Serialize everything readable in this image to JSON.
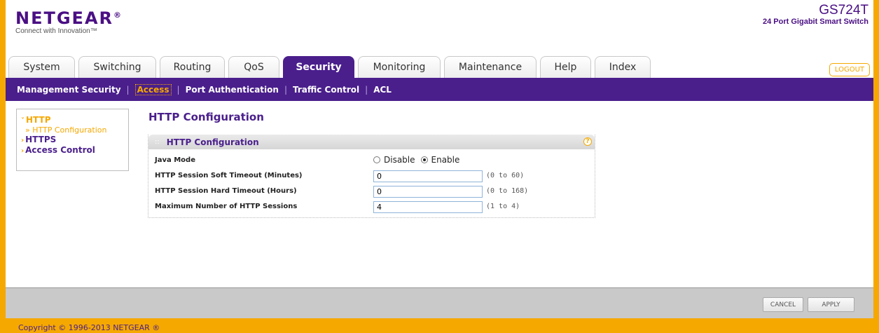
{
  "header": {
    "logo": "NETGEAR",
    "logo_mark": "®",
    "tagline": "Connect with Innovation™",
    "model": "GS724T",
    "description": "24 Port Gigabit Smart Switch",
    "logout_label": "LOGOUT"
  },
  "tabs": [
    {
      "label": "System"
    },
    {
      "label": "Switching"
    },
    {
      "label": "Routing"
    },
    {
      "label": "QoS"
    },
    {
      "label": "Security",
      "active": true
    },
    {
      "label": "Monitoring"
    },
    {
      "label": "Maintenance"
    },
    {
      "label": "Help"
    },
    {
      "label": "Index"
    }
  ],
  "subnav": [
    {
      "label": "Management Security"
    },
    {
      "label": "Access",
      "active": true
    },
    {
      "label": "Port Authentication"
    },
    {
      "label": "Traffic Control"
    },
    {
      "label": "ACL"
    }
  ],
  "sidebar": {
    "http": "HTTP",
    "http_config": "» HTTP Configuration",
    "https": "HTTPS",
    "access_control": "Access Control"
  },
  "page": {
    "title": "HTTP Configuration"
  },
  "panel": {
    "title": "HTTP Configuration",
    "help_icon": "?",
    "java_mode_label": "Java Mode",
    "java_mode_options": [
      "Disable",
      "Enable"
    ],
    "java_mode_selected": "Enable",
    "soft_timeout_label": "HTTP Session Soft Timeout (Minutes)",
    "soft_timeout_value": "0",
    "soft_timeout_range": "(0 to 60)",
    "hard_timeout_label": "HTTP Session Hard Timeout (Hours)",
    "hard_timeout_value": "0",
    "hard_timeout_range": "(0 to 168)",
    "max_sessions_label": "Maximum Number of HTTP Sessions",
    "max_sessions_value": "4",
    "max_sessions_range": "(1 to 4)"
  },
  "footer": {
    "cancel_label": "CANCEL",
    "apply_label": "APPLY",
    "copyright": "Copyright © 1996-2013 NETGEAR ®"
  }
}
